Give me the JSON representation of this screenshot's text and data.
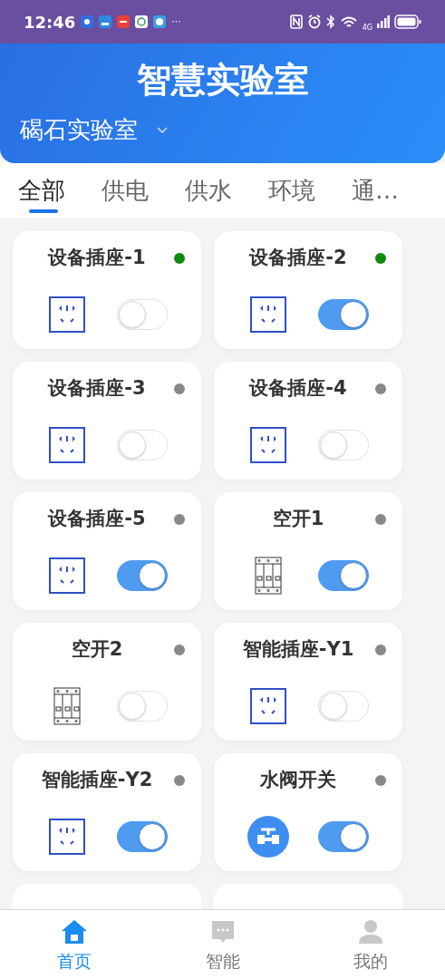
{
  "status_bar": {
    "time": "12:46",
    "more": "···",
    "network": "4G"
  },
  "header": {
    "title": "智慧实验室",
    "lab": "碣石实验室"
  },
  "tabs": [
    {
      "label": "全部",
      "selected": true
    },
    {
      "label": "供电",
      "selected": false
    },
    {
      "label": "供水",
      "selected": false
    },
    {
      "label": "环境",
      "selected": false
    },
    {
      "label": "通…",
      "selected": false
    }
  ],
  "devices": [
    {
      "name": "设备插座-1",
      "kind": "socket",
      "color": "#108a10",
      "on": false
    },
    {
      "name": "设备插座-2",
      "kind": "socket",
      "color": "#108a10",
      "on": true
    },
    {
      "name": "设备插座-3",
      "kind": "socket",
      "color": "#888888",
      "on": false
    },
    {
      "name": "设备插座-4",
      "kind": "socket",
      "color": "#888888",
      "on": false
    },
    {
      "name": "设备插座-5",
      "kind": "socket",
      "color": "#888888",
      "on": true
    },
    {
      "name": "空开1",
      "kind": "breaker",
      "color": "#888888",
      "on": true
    },
    {
      "name": "空开2",
      "kind": "breaker",
      "color": "#888888",
      "on": false
    },
    {
      "name": "智能插座-Y1",
      "kind": "socket",
      "color": "#888888",
      "on": false
    },
    {
      "name": "智能插座-Y2",
      "kind": "socket",
      "color": "#888888",
      "on": true
    },
    {
      "name": "水阀开关",
      "kind": "valve",
      "color": "#888888",
      "on": true
    }
  ],
  "nav": [
    {
      "label": "首页",
      "kind": "home",
      "selected": true
    },
    {
      "label": "智能",
      "kind": "chat",
      "selected": false
    },
    {
      "label": "我的",
      "kind": "user",
      "selected": false
    }
  ]
}
